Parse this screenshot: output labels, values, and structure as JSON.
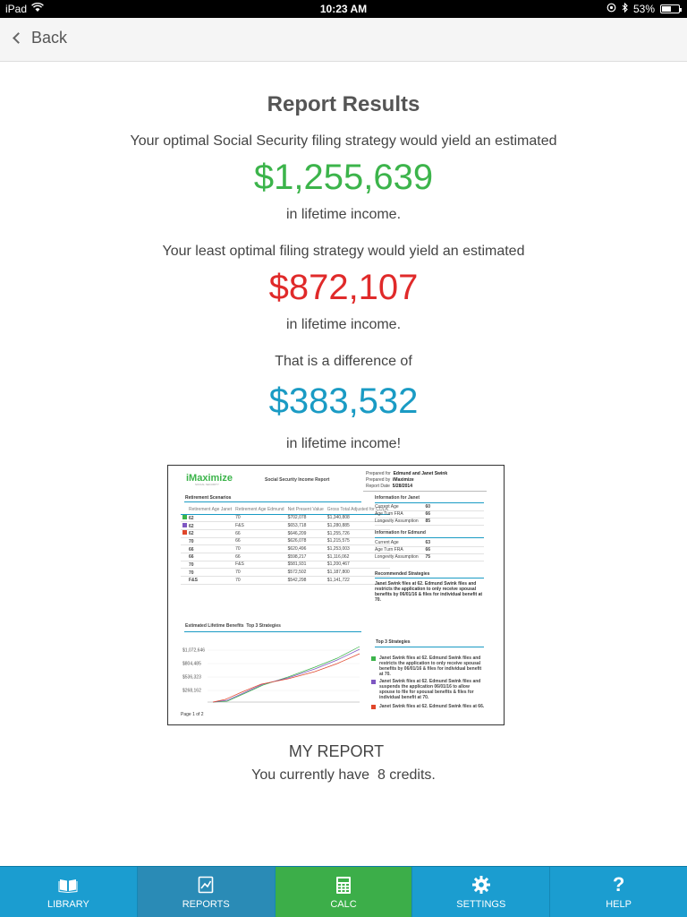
{
  "status": {
    "device": "iPad",
    "time": "10:23 AM",
    "battery": "53%",
    "battery_level": 0.53
  },
  "nav": {
    "back_label": "Back"
  },
  "report": {
    "title": "Report Results",
    "optimal_intro": "Your optimal Social Security filing strategy would yield an estimated",
    "optimal_amount": "$1,255,639",
    "optimal_suffix": "in lifetime income.",
    "least_intro": "Your least optimal filing strategy would yield an estimated",
    "least_amount": "$872,107",
    "least_suffix": "in lifetime income.",
    "difference_intro": "That is a difference of",
    "difference_amount": "$383,532",
    "difference_suffix": "in lifetime income!"
  },
  "thumbnail": {
    "logo": "iMaximize",
    "logo_sub": "SOCIAL SECURITY",
    "title": "Social Security Income Report",
    "prepared_for_label": "Prepared for",
    "prepared_for": "Edmund and Janet Swink",
    "prepared_by_label": "Prepared by",
    "prepared_by": "iMaximize",
    "report_date_label": "Report Date",
    "report_date": "5/28/2014",
    "scenarios_heading": "Retirement Scenarios",
    "table_headers": [
      "Retirement Age Janet",
      "Retirement Age Edmund",
      "Net Present Value",
      "Gross Total Adjusted for COLA"
    ],
    "rows": [
      {
        "a": "62",
        "b": "70",
        "npv": "$702,078",
        "gross": "$1,340,808",
        "color": "#3cb44b"
      },
      {
        "a": "62",
        "b": "F&S",
        "npv": "$653,718",
        "gross": "$1,280,885",
        "color": "#7e57c2"
      },
      {
        "a": "62",
        "b": "66",
        "npv": "$646,209",
        "gross": "$1,255,726",
        "color": "#e0462a"
      },
      {
        "a": "70",
        "b": "66",
        "npv": "$626,078",
        "gross": "$1,215,575",
        "color": ""
      },
      {
        "a": "66",
        "b": "70",
        "npv": "$620,496",
        "gross": "$1,253,003",
        "color": ""
      },
      {
        "a": "66",
        "b": "66",
        "npv": "$598,217",
        "gross": "$1,116,062",
        "color": ""
      },
      {
        "a": "70",
        "b": "F&S",
        "npv": "$581,931",
        "gross": "$1,200,467",
        "color": ""
      },
      {
        "a": "70",
        "b": "70",
        "npv": "$572,502",
        "gross": "$1,187,800",
        "color": ""
      },
      {
        "a": "F&S",
        "b": "70",
        "npv": "$542,298",
        "gross": "$1,141,722",
        "color": ""
      }
    ],
    "info_janet_label": "Information for",
    "info_janet_name": "Janet",
    "info_janet": [
      [
        "Current Age",
        "60"
      ],
      [
        "Age Turn FRA",
        "66"
      ],
      [
        "Longevity Assumption",
        "85"
      ]
    ],
    "info_edmund_label": "Information for",
    "info_edmund_name": "Edmund",
    "info_edmund": [
      [
        "Current Age",
        "63"
      ],
      [
        "Age Turn FRA",
        "66"
      ],
      [
        "Longevity Assumption",
        "75"
      ]
    ],
    "recommended_heading": "Recommended Strategies",
    "recommended_text": "Janet Swink files at 62. Edmund Swink files and restricts the application to only receive spousal benefits by 06/01/16 & files for individual benefit at 70.",
    "chart_heading": "Estimated Lifetime Benefits",
    "chart_subheading": "Top 3 Strategies",
    "y_ticks": [
      "$1,072,646",
      "$804,485",
      "$536,323",
      "$268,162"
    ],
    "top3_heading": "Top 3 Strategies",
    "top3": [
      {
        "text": "Janet Swink files at 62. Edmund Swink files and restricts the application to only receive spousal benefits by 06/01/16 & files for individual benefit at 70.",
        "color": "#3cb44b"
      },
      {
        "text": "Janet Swink files at 62. Edmund Swink files and suspends the application 06/01/16 to allow spouse to file for spousal benefits & files for individual benefit at 70.",
        "color": "#7e57c2"
      },
      {
        "text": "Janet Swink files at 62. Edmund Swink files at 66.",
        "color": "#e0462a"
      }
    ],
    "page_label": "Page 1 of 2"
  },
  "my_report": {
    "heading": "MY REPORT",
    "credits_prefix": "You currently have",
    "credits": "8",
    "credits_suffix": "credits."
  },
  "tabs": [
    {
      "label": "LIBRARY",
      "icon": "book-icon"
    },
    {
      "label": "REPORTS",
      "icon": "report-icon"
    },
    {
      "label": "CALC",
      "icon": "calculator-icon"
    },
    {
      "label": "SETTINGS",
      "icon": "gear-icon"
    },
    {
      "label": "HELP",
      "icon": "question-icon"
    }
  ],
  "colors": {
    "green": "#3cb44b",
    "red": "#e02a2a",
    "blue": "#1a9bc4",
    "tabbar": "#1b9dd0",
    "active_tab": "#3cae49"
  }
}
